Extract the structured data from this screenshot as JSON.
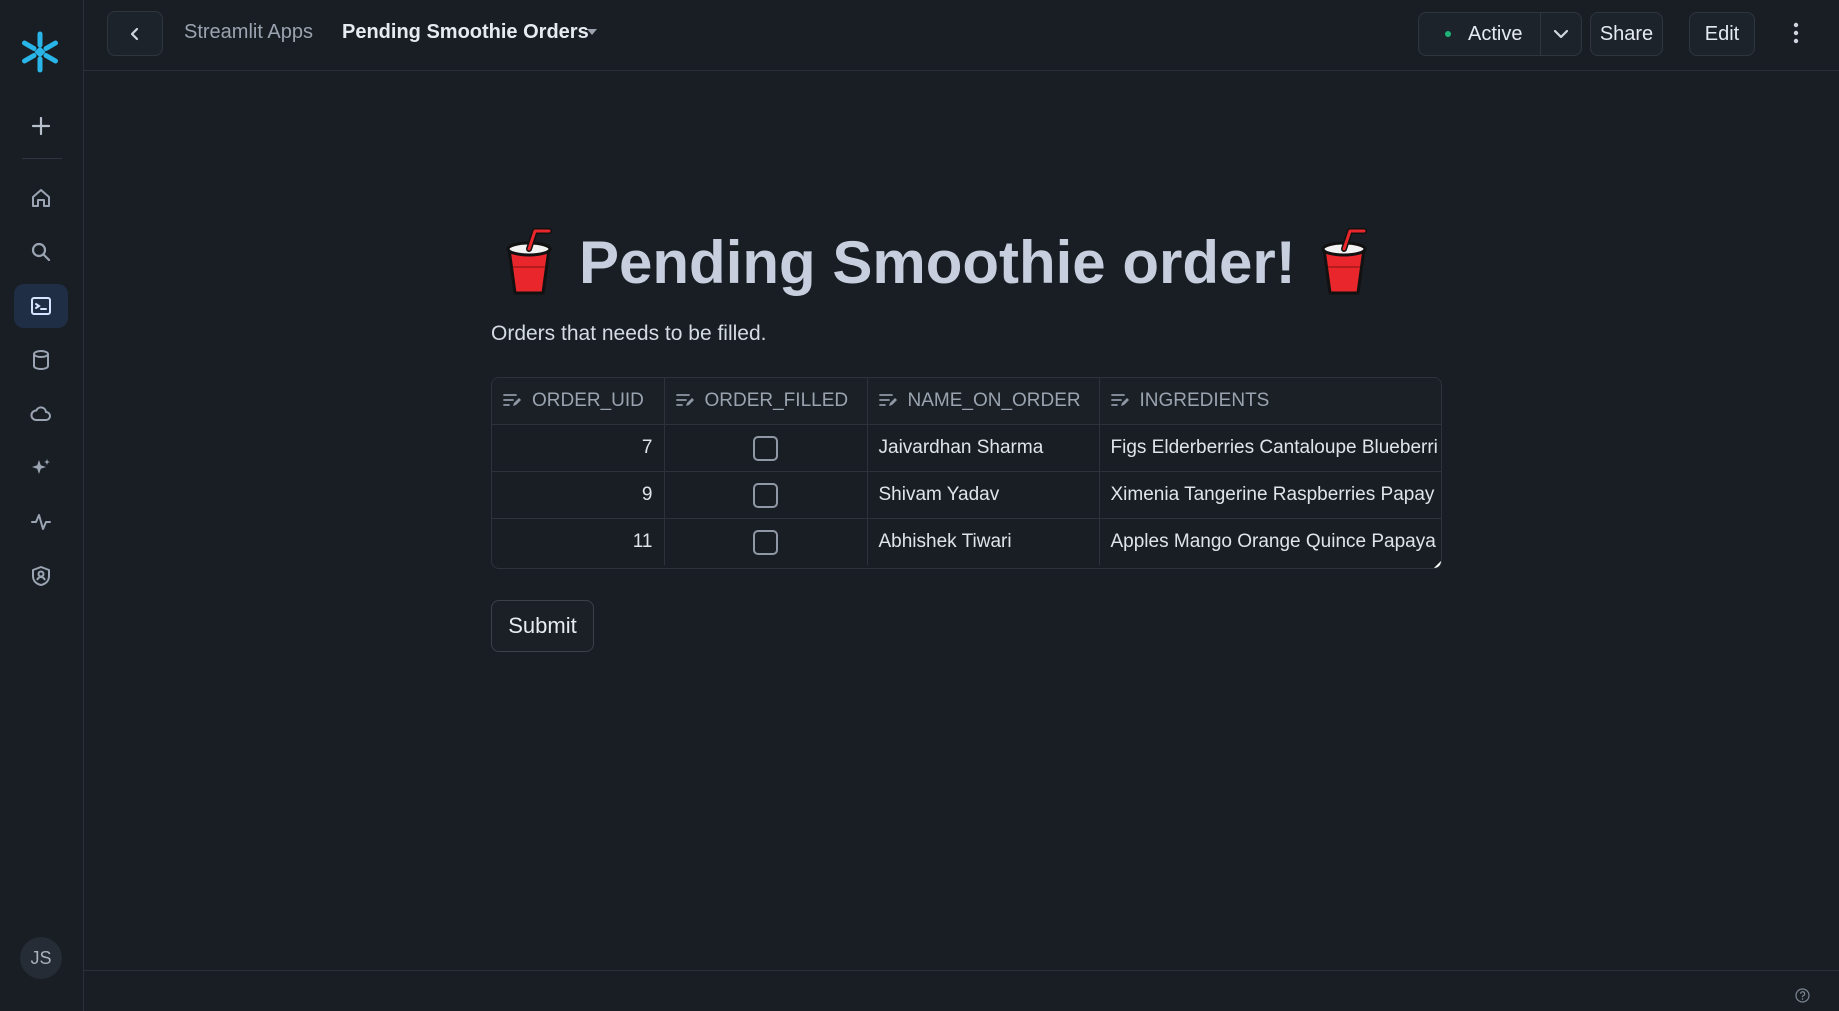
{
  "topbar": {
    "breadcrumb_parent": "Streamlit Apps",
    "app_title": "Pending Smoothie Orders",
    "status_label": "Active",
    "status_color": "#1fb37a",
    "share_label": "Share",
    "edit_label": "Edit"
  },
  "sidebar": {
    "logo": "snowflake-logo",
    "items": [
      {
        "icon": "plus-icon"
      },
      {
        "icon": "home-icon"
      },
      {
        "icon": "search-icon"
      },
      {
        "icon": "terminal-icon",
        "active": true
      },
      {
        "icon": "database-icon"
      },
      {
        "icon": "cloud-icon"
      },
      {
        "icon": "sparkle-icon"
      },
      {
        "icon": "activity-icon"
      },
      {
        "icon": "shield-user-icon"
      }
    ],
    "user_initials": "JS"
  },
  "main": {
    "title": "Pending Smoothie order!",
    "subtitle": "Orders that needs to be filled.",
    "table": {
      "columns": [
        "ORDER_UID",
        "ORDER_FILLED",
        "NAME_ON_ORDER",
        "INGREDIENTS"
      ],
      "rows": [
        {
          "order_uid": "7",
          "order_filled": false,
          "name_on_order": "Jaivardhan Sharma",
          "ingredients": "Figs Elderberries Cantaloupe Blueberri"
        },
        {
          "order_uid": "9",
          "order_filled": false,
          "name_on_order": "Shivam Yadav",
          "ingredients": "Ximenia Tangerine Raspberries Papay"
        },
        {
          "order_uid": "11",
          "order_filled": false,
          "name_on_order": "Abhishek Tiwari",
          "ingredients": "Apples Mango Orange Quince Papaya"
        }
      ]
    },
    "submit_label": "Submit"
  }
}
